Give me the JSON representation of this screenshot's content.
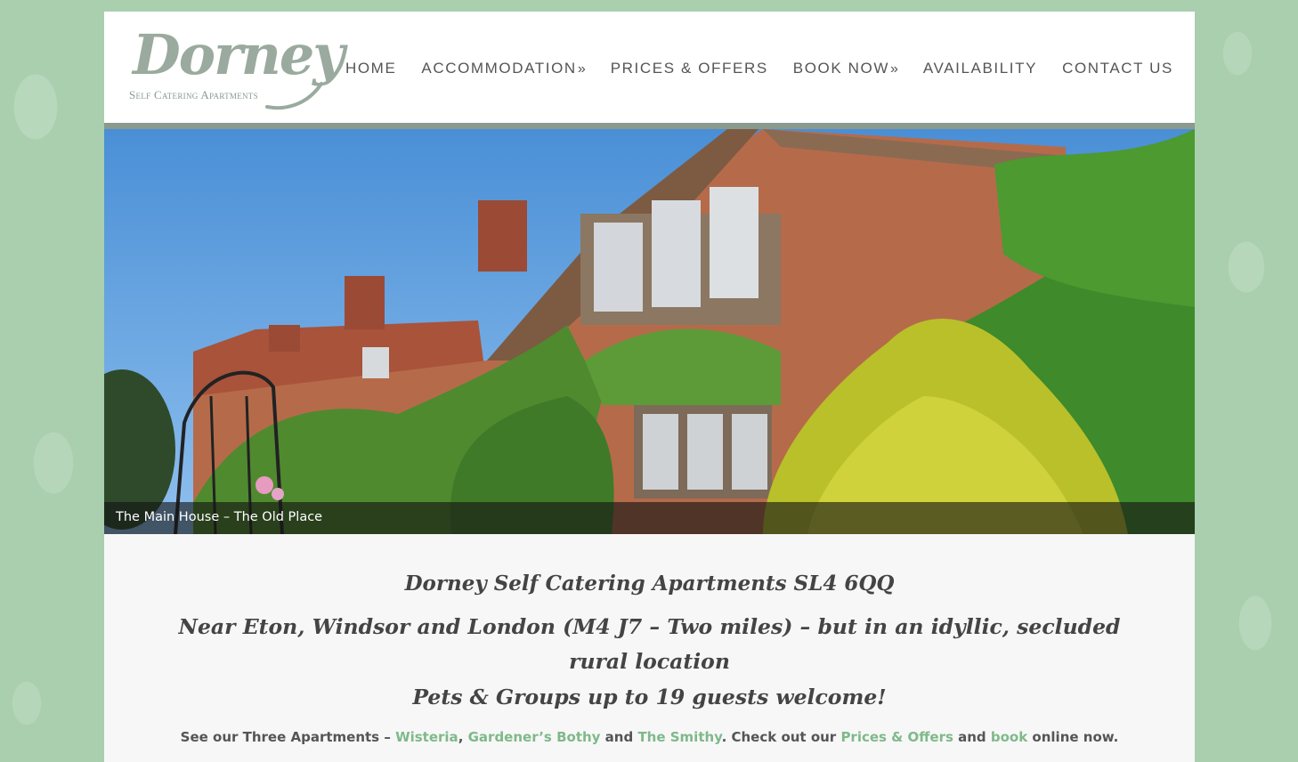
{
  "logo": {
    "word": "Dorney",
    "tagline": "Self Catering Apartments"
  },
  "nav": {
    "items": [
      {
        "label": "HOME",
        "has_submenu": false
      },
      {
        "label": "ACCOMMODATION",
        "has_submenu": true
      },
      {
        "label": "PRICES & OFFERS",
        "has_submenu": false
      },
      {
        "label": "BOOK NOW",
        "has_submenu": true
      },
      {
        "label": "AVAILABILITY",
        "has_submenu": false
      },
      {
        "label": "CONTACT US",
        "has_submenu": false
      }
    ],
    "submenu_arrow": "»"
  },
  "hero": {
    "caption": "The Main House – The Old Place"
  },
  "content": {
    "title": "Dorney Self Catering Apartments SL4 6QQ",
    "subtitle": "Near Eton, Windsor and London (M4 J7 – Two miles) – but in an idyllic, secluded rural location",
    "welcome": "Pets & Groups up to 19 guests welcome!",
    "intro": {
      "prefix": "See our Three Apartments – ",
      "link_wisteria": "Wisteria",
      "sep1": ", ",
      "link_bothy": "Gardener’s Bothy",
      "sep2": " and ",
      "link_smithy": "The Smithy",
      "mid": ". Check out our ",
      "link_prices": "Prices & Offers",
      "sep3": " and ",
      "link_book": "book",
      "suffix": " online now."
    }
  },
  "colors": {
    "background": "#a9cfae",
    "link": "#7fb98a",
    "header_border": "#8a9a8e",
    "logo": "#9aaa9e"
  }
}
